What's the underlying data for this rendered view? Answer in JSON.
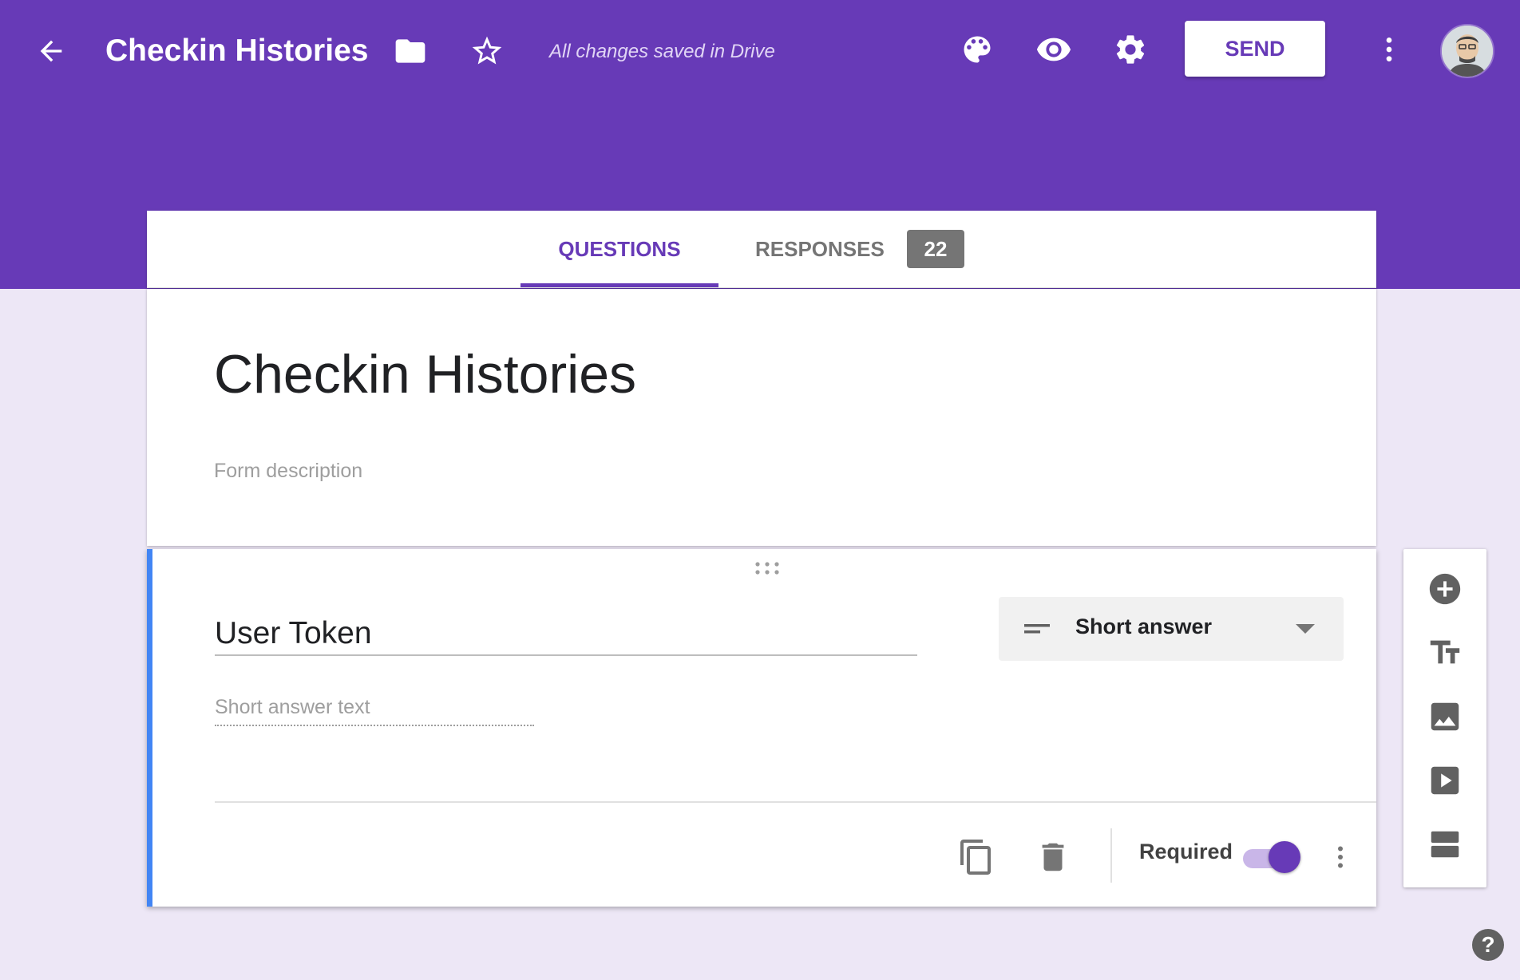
{
  "header": {
    "title": "Checkin Histories",
    "save_status": "All changes saved in Drive",
    "send_label": "SEND"
  },
  "tabs": {
    "questions": "QUESTIONS",
    "responses": "RESPONSES",
    "responses_count": "22"
  },
  "form": {
    "title": "Checkin Histories",
    "description_placeholder": "Form description"
  },
  "question": {
    "title": "User Token",
    "type": "Short answer",
    "answer_placeholder": "Short answer text",
    "required_label": "Required",
    "required": true
  },
  "help": "?",
  "colors": {
    "brand": "#673ab7",
    "background": "#ede7f6",
    "active_border": "#4285f4"
  },
  "icons": {
    "header": [
      "back-arrow-icon",
      "folder-icon",
      "star-icon",
      "palette-icon",
      "eye-icon",
      "gear-icon",
      "more-vert-icon"
    ],
    "side_toolbar": [
      "add-circle-icon",
      "text-title-icon",
      "image-icon",
      "video-icon",
      "section-icon"
    ],
    "question_footer": [
      "duplicate-icon",
      "trash-icon",
      "more-vert-icon"
    ]
  }
}
